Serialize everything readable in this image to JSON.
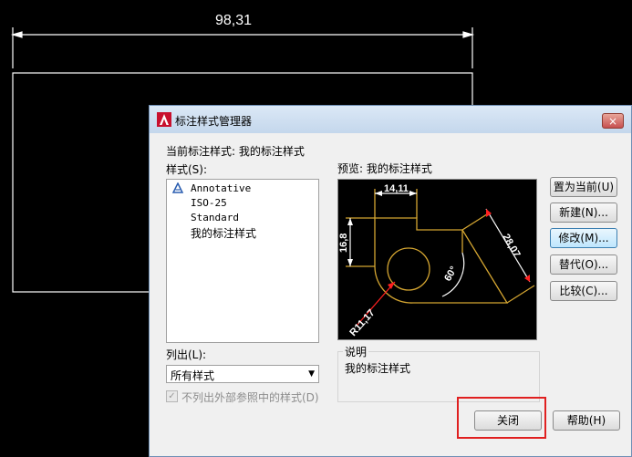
{
  "drawing": {
    "dimension_text": "98,31"
  },
  "dialog": {
    "title": "标注样式管理器",
    "close_label": "×",
    "current_style_label": "当前标注样式: 我的标注样式",
    "styles_label": "样式(S):",
    "styles": [
      "Annotative",
      "ISO-25",
      "Standard",
      "我的标注样式"
    ],
    "preview_label": "预览: 我的标注样式",
    "preview_dims": {
      "top": "14,11",
      "left": "16,8",
      "diagonal": "28,07",
      "angle": "60°",
      "radius": "R11,17"
    },
    "list_label": "列出(L):",
    "list_value": "所有样式",
    "exclude_xref_label": "不列出外部参照中的样式(D)",
    "exclude_xref_checked": true,
    "description_label": "说明",
    "description_text": "我的标注样式",
    "buttons": {
      "set_current": "置为当前(U)",
      "new": "新建(N)...",
      "modify": "修改(M)...",
      "override": "替代(O)...",
      "compare": "比较(C)...",
      "close": "关闭",
      "help": "帮助(H)"
    }
  },
  "colors": {
    "annotation_highlight": "#e02020",
    "preview_yellow": "#d4a531",
    "preview_red": "#ff2020"
  }
}
